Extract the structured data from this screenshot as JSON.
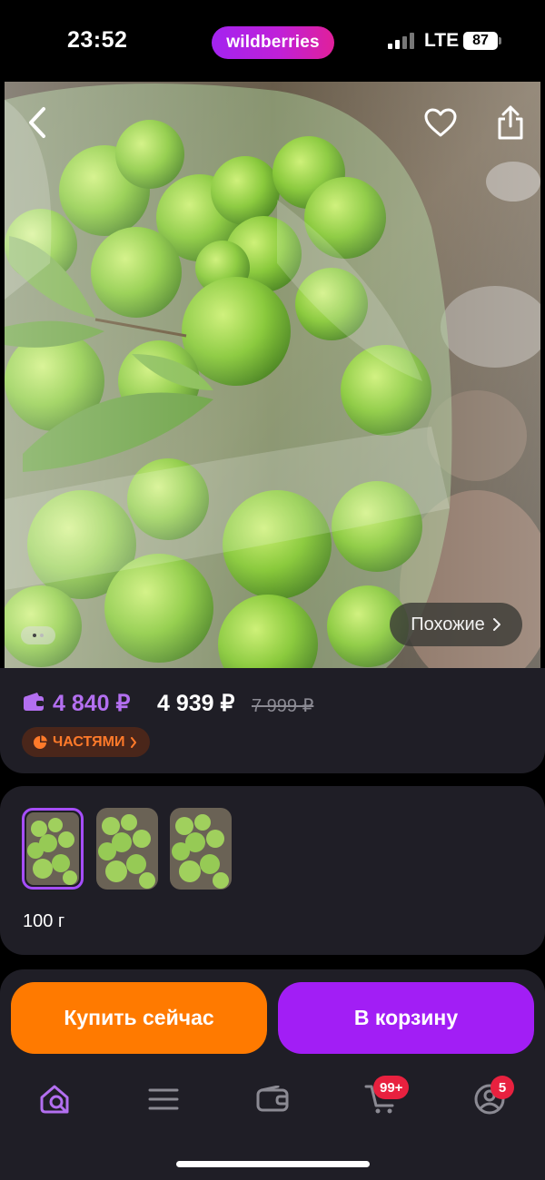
{
  "status_bar": {
    "time": "23:52",
    "carrier": "LTE",
    "battery": "87"
  },
  "brand": {
    "name": "wildberries",
    "gradient": [
      "#a324f0",
      "#e0209a"
    ]
  },
  "gallery": {
    "similar_label": "Похожие",
    "page_dots": 2,
    "active_dot": 1
  },
  "price": {
    "wallet_price": "4 840 ₽",
    "price": "4 939 ₽",
    "old_price": "7 999 ₽",
    "installment_label": "ЧАСТЯМИ",
    "accent": "#b36ff0",
    "installment_color": "#ff7a2a"
  },
  "variants": {
    "count": 3,
    "selected_index": 0,
    "weight": "100 г"
  },
  "actions": {
    "buy_now": "Купить сейчас",
    "add_to_cart": "В корзину",
    "buy_color": "#ff7a00",
    "cart_color": "#a21ef5"
  },
  "nav": {
    "items": [
      {
        "name": "search",
        "icon": "home-search-icon"
      },
      {
        "name": "catalog",
        "icon": "menu-icon"
      },
      {
        "name": "wallet",
        "icon": "wallet-icon"
      },
      {
        "name": "cart",
        "icon": "cart-icon",
        "badge": "99+"
      },
      {
        "name": "profile",
        "icon": "profile-icon",
        "badge": "5"
      }
    ],
    "active_color": "#b36ff0"
  }
}
